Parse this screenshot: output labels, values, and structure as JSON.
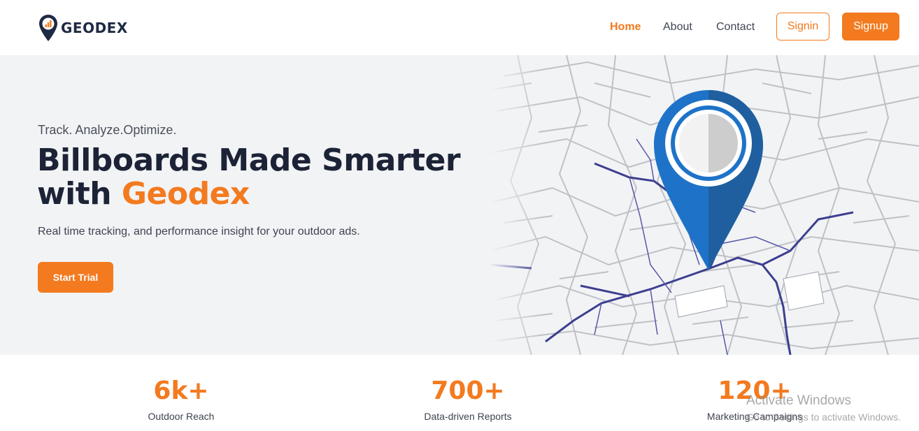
{
  "brand": {
    "name": "GEODEX",
    "accent": "#f37a1f",
    "dark": "#1c2336"
  },
  "nav": {
    "links": [
      {
        "label": "Home",
        "active": true
      },
      {
        "label": "About",
        "active": false
      },
      {
        "label": "Contact",
        "active": false
      }
    ],
    "signin_label": "Signin",
    "signup_label": "Signup"
  },
  "hero": {
    "tagline": "Track. Analyze.Optimize.",
    "headline_line1": "Billboards Made Smarter",
    "headline_with": "with ",
    "headline_accent": "Geodex",
    "subtext": "Real time tracking, and performance insight for your outdoor ads.",
    "cta_label": "Start Trial",
    "illustration": "map-pin-city-map"
  },
  "stats": [
    {
      "value": "6k+",
      "label": "Outdoor Reach"
    },
    {
      "value": "700+",
      "label": "Data-driven Reports"
    },
    {
      "value": "120+",
      "label": "Marketing Campaigns"
    }
  ],
  "watermark": {
    "title": "Activate Windows",
    "subtitle": "Go to Settings to activate Windows."
  }
}
